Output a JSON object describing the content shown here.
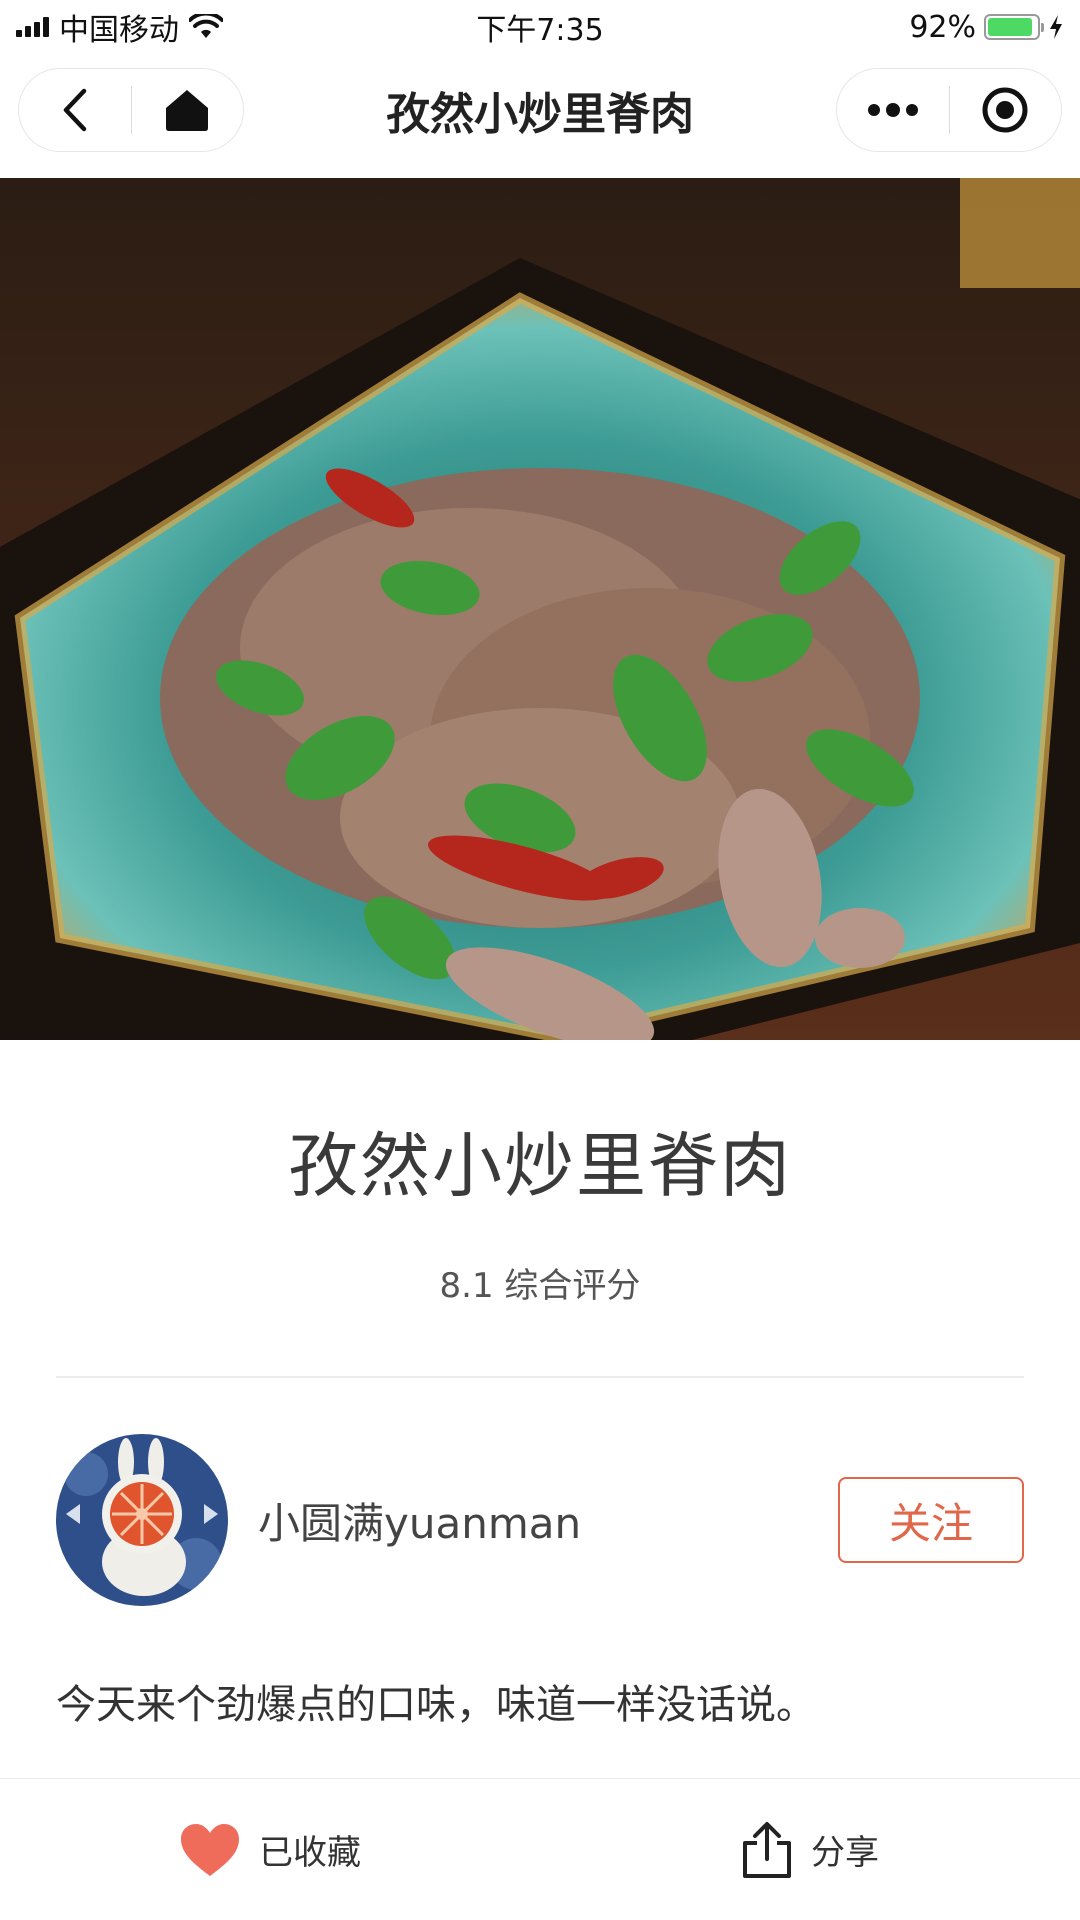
{
  "status_bar": {
    "carrier": "中国移动",
    "time": "下午7:35",
    "battery_percent": "92%",
    "battery_level": 0.92,
    "battery_color": "#4cd964"
  },
  "nav": {
    "title": "孜然小炒里脊肉",
    "back_icon": "chevron-left-icon",
    "home_icon": "home-icon",
    "more_icon": "more-dots-icon",
    "target_icon": "record-target-icon"
  },
  "recipe": {
    "title": "孜然小炒里脊肉",
    "rating": "8.1 综合评分"
  },
  "author": {
    "name": "小圆满yuanman",
    "follow_label": "关注",
    "accent_color": "#e0674a"
  },
  "description": "今天来个劲爆点的口味，味道一样没话说。",
  "bottom_bar": {
    "favorite_label": "已收藏",
    "favorite_icon": "heart-icon",
    "favorite_color": "#ef6c5a",
    "share_label": "分享",
    "share_icon": "share-icon"
  }
}
